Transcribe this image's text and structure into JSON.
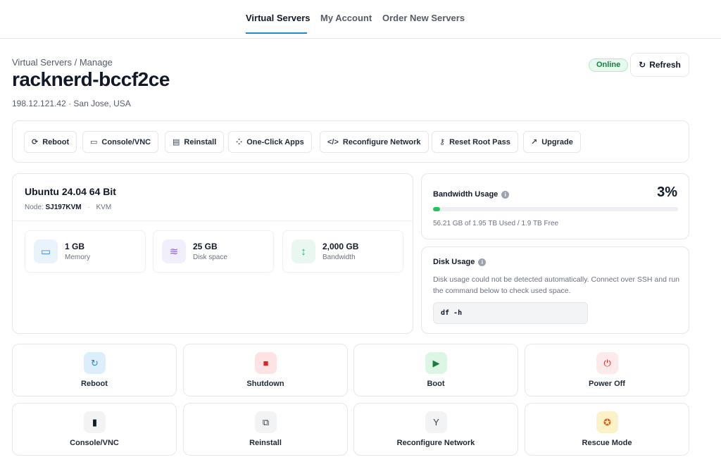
{
  "nav": {
    "tabs": [
      {
        "label": "Virtual Servers",
        "active": true
      },
      {
        "label": "My Account",
        "active": false
      },
      {
        "label": "Order New Servers",
        "active": false
      }
    ]
  },
  "header": {
    "breadcrumb": "Virtual Servers / Manage",
    "title": "racknerd-bccf2ce",
    "subtitle": "198.12.121.42 · San Jose, USA",
    "status": "Online",
    "refresh_label": "Refresh",
    "refresh_icon": "↻"
  },
  "toolbar": {
    "buttons": [
      {
        "label": "Reboot",
        "icon": "⟳"
      },
      {
        "label": "Console/VNC",
        "icon": "▭"
      },
      {
        "label": "Reinstall",
        "icon": "▤"
      },
      {
        "label": "One-Click Apps",
        "icon": "⁘"
      },
      {
        "label": "Reconfigure Network",
        "icon": "</>"
      },
      {
        "label": "Reset Root Pass",
        "icon": "⚷"
      },
      {
        "label": "Upgrade",
        "icon": "↗"
      }
    ]
  },
  "os_card": {
    "title": "Ubuntu 24.04 64 Bit",
    "node_label": "Node:",
    "node_value": "SJ197KVM",
    "virtualization": "KVM",
    "specs": [
      {
        "value": "1 GB",
        "label": "Memory",
        "icon": "▭",
        "color": "#3b82f6",
        "bg": "#e8f3fc"
      },
      {
        "value": "25 GB",
        "label": "Disk space",
        "icon": "≋",
        "color": "#8b5cf6",
        "bg": "#f2effd"
      },
      {
        "value": "2,000 GB",
        "label": "Bandwidth",
        "icon": "↕",
        "color": "#10b981",
        "bg": "#e8f8f1"
      }
    ]
  },
  "bandwidth": {
    "title": "Bandwidth Usage",
    "percent_label": "3%",
    "percent": 3,
    "note": "56.21 GB of 1.95 TB Used / 1.9 TB Free"
  },
  "disk": {
    "title": "Disk Usage",
    "description": "Disk usage could not be detected automatically. Connect over SSH and run the command below to check used space.",
    "command": "df -h"
  },
  "actions": [
    {
      "label": "Reboot",
      "icon": "↻",
      "color": "#1d8bd1",
      "bg": "#dbeefa"
    },
    {
      "label": "Shutdown",
      "icon": "■",
      "color": "#dc2626",
      "bg": "#fde3e3"
    },
    {
      "label": "Boot",
      "icon": "▶",
      "color": "#15803d",
      "bg": "#dcf5e4"
    },
    {
      "label": "Power Off",
      "icon": "⏻",
      "color": "#dc2626",
      "bg": "#fdeaea"
    },
    {
      "label": "Console/VNC",
      "icon": "▮",
      "color": "#111827",
      "bg": "#f1f3f5"
    },
    {
      "label": "Reinstall",
      "icon": "⧉",
      "color": "#374151",
      "bg": "#f1f3f5"
    },
    {
      "label": "Reconfigure Network",
      "icon": "Y",
      "color": "#374151",
      "bg": "#f1f3f5"
    },
    {
      "label": "Rescue Mode",
      "icon": "✪",
      "color": "#ea580c",
      "bg": "#fdf1c7"
    }
  ]
}
